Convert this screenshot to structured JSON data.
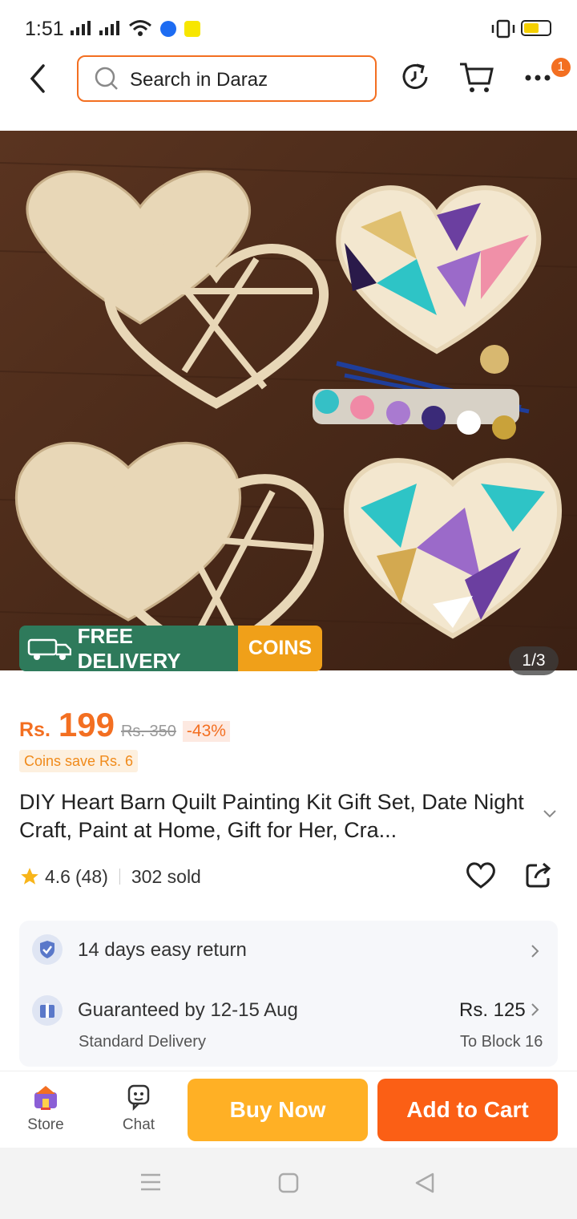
{
  "status_bar": {
    "time": "1:51",
    "battery_color": "#f5d000"
  },
  "header": {
    "search_placeholder": "Search in Daraz",
    "cart_badge": "1",
    "accent": "#f36f21"
  },
  "gallery": {
    "free_delivery": "FREE DELIVERY",
    "free_tag": "FREE",
    "coins": "COINS",
    "counter": "1/3"
  },
  "product": {
    "currency": "Rs.",
    "price": "199",
    "old_price": "Rs. 350",
    "discount": "-43%",
    "coins_save": "Coins save Rs. 6",
    "title": "DIY Heart Barn Quilt Painting Kit Gift Set, Date Night Craft, Paint at Home, Gift for Her, Cra...",
    "rating": "4.6",
    "reviews": "(48)",
    "sold": "302 sold"
  },
  "services": {
    "return_label": "14 days easy return",
    "delivery_label": "Guaranteed by 12-15 Aug",
    "delivery_type": "Standard Delivery",
    "delivery_fee": "Rs. 125",
    "delivery_to": "To Block 16"
  },
  "bottom_bar": {
    "store": "Store",
    "chat": "Chat",
    "buy_now": "Buy Now",
    "add_to_cart": "Add to Cart"
  }
}
